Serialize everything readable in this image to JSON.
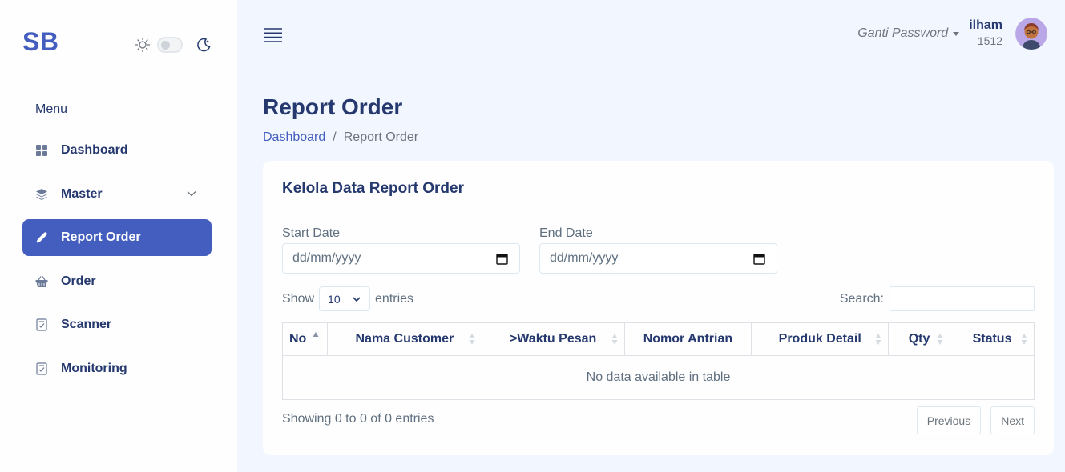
{
  "brand": "SB",
  "sidebar": {
    "menu_title": "Menu",
    "items": [
      {
        "label": "Dashboard",
        "icon": "grid-icon"
      },
      {
        "label": "Master",
        "icon": "stack-icon"
      },
      {
        "label": "Report Order",
        "icon": "pen-icon"
      },
      {
        "label": "Order",
        "icon": "basket-icon"
      },
      {
        "label": "Scanner",
        "icon": "checklist-icon"
      },
      {
        "label": "Monitoring",
        "icon": "checklist-icon"
      }
    ]
  },
  "header": {
    "account_menu": "Ganti Password",
    "user_name": "ilham",
    "user_id": "1512"
  },
  "page": {
    "title": "Report Order",
    "breadcrumb": {
      "home": "Dashboard",
      "separator": "/",
      "current": "Report Order"
    }
  },
  "card": {
    "title": "Kelola Data Report Order",
    "start_date": {
      "label": "Start Date",
      "value": "dd/mm/yyyy"
    },
    "end_date": {
      "label": "End Date",
      "value": "dd/mm/yyyy"
    },
    "length": {
      "prefix": "Show",
      "value": "10",
      "suffix": "entries"
    },
    "search_label": "Search:",
    "columns": [
      "No",
      "Nama Customer",
      ">Waktu Pesan",
      "Nomor Antrian",
      "Produk Detail",
      "Qty",
      "Status"
    ],
    "empty_message": "No data available in table",
    "info": "Showing 0 to 0 of 0 entries",
    "prev_label": "Previous",
    "next_label": "Next"
  },
  "colors": {
    "accent": "#435ebe",
    "background": "#f2f7ff",
    "text": "#25396f"
  }
}
